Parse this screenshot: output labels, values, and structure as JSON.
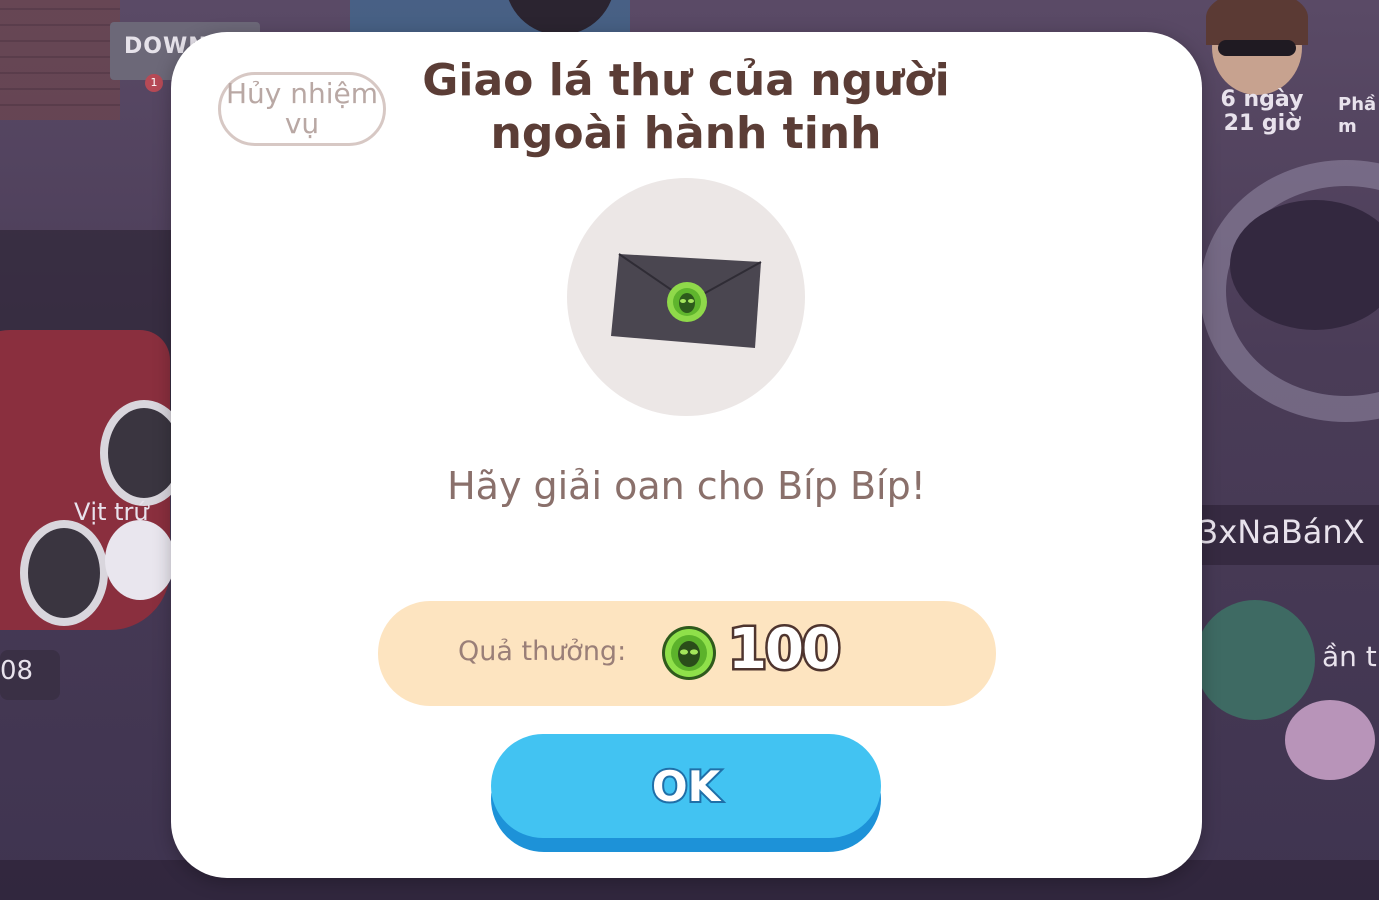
{
  "background": {
    "shop_sign": "DOWN",
    "notification_count": "1",
    "timer_text": "6 ngày 21 giờ",
    "side_label": "Phầ m",
    "npc_name": "Vịt trứ",
    "left_counter": "08",
    "player_name": "3xNaBánX",
    "right_label": "ần t"
  },
  "modal": {
    "cancel_label": "Hủy nhiệm vụ",
    "title": "Giao lá thư của người ngoài hành tinh",
    "quest_icon": "alien-letter-icon",
    "message": "Hãy giải oan cho Bíp Bíp!",
    "reward": {
      "label": "Quả thưởng:",
      "currency_icon": "alien-coin-icon",
      "amount": "100"
    },
    "ok_label": "OK"
  },
  "colors": {
    "title": "#5b3d36",
    "reward_bar": "#fde4c0",
    "ok_button": "#42c3f2",
    "coin_green": "#7bd13a"
  }
}
